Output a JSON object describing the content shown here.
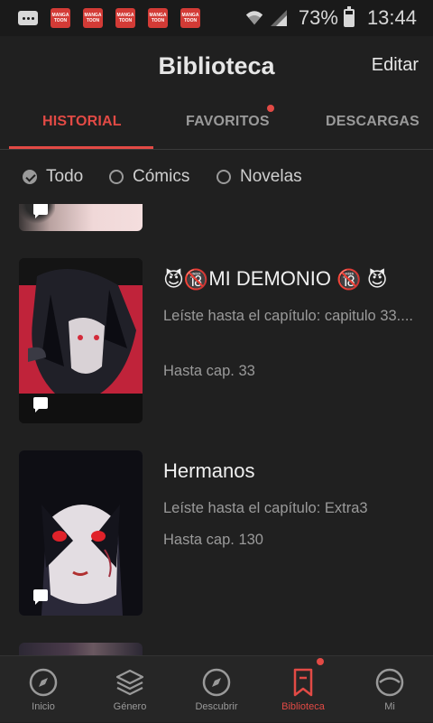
{
  "status_bar": {
    "app_icon_label_top": "MANGA",
    "app_icon_label_bottom": "TOON",
    "battery_percent": "73%",
    "battery_level": 0.73,
    "time": "13:44"
  },
  "header": {
    "title": "Biblioteca",
    "edit_label": "Editar"
  },
  "tabs": [
    {
      "label": "HISTORIAL",
      "active": true
    },
    {
      "label": "FAVORITOS",
      "active": false,
      "badge_dot": true
    },
    {
      "label": "DESCARGAS",
      "active": false
    }
  ],
  "filters": [
    {
      "label": "Todo",
      "checked": true
    },
    {
      "label": "Cómics",
      "checked": false
    },
    {
      "label": "Novelas",
      "checked": false
    }
  ],
  "items": [
    {
      "title_emoji_left": "😈🔞",
      "title_text": "MI DEMONIO",
      "title_emoji_right": "🔞 😈",
      "progress": "Leíste hasta el capítulo: capitulo 33....",
      "upto": "Hasta cap. 33"
    },
    {
      "title_text": "Hermanos",
      "progress": "Leíste hasta el capítulo: Extra3",
      "upto": "Hasta cap. 130"
    }
  ],
  "bottom_nav": [
    {
      "label": "Inicio",
      "icon": "compass-icon",
      "active": false
    },
    {
      "label": "Género",
      "icon": "layers-icon",
      "active": false
    },
    {
      "label": "Descubrir",
      "icon": "compass-icon",
      "active": false
    },
    {
      "label": "Biblioteca",
      "icon": "bookmark-icon",
      "active": true,
      "badge_dot": true
    },
    {
      "label": "Mi",
      "icon": "face-icon",
      "active": false
    }
  ],
  "colors": {
    "accent": "#e24a45",
    "background": "#202020",
    "muted_text": "#9a9a9a"
  }
}
